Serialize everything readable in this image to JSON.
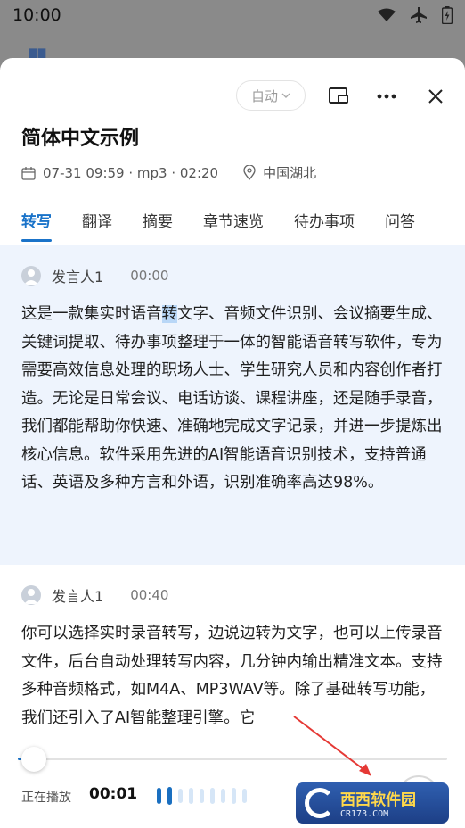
{
  "status_bar": {
    "time": "10:00"
  },
  "header": {
    "auto_label": "自动"
  },
  "record": {
    "title": "简体中文示例",
    "date": "07-31 09:59 · mp3 · 02:20",
    "location": "中国湖北"
  },
  "tabs": [
    {
      "label": "转写",
      "active": true
    },
    {
      "label": "翻译",
      "active": false
    },
    {
      "label": "摘要",
      "active": false
    },
    {
      "label": "章节速览",
      "active": false
    },
    {
      "label": "待办事项",
      "active": false
    },
    {
      "label": "问答",
      "active": false
    }
  ],
  "segments": [
    {
      "speaker": "发言人1",
      "time": "00:00",
      "text_before": "这是一款集实时语音",
      "text_highlight": "转",
      "text_after": "文字、音频文件识别、会议摘要生成、关键词提取、待办事项整理于一体的智能语音转写软件，专为需要高效信息处理的职场人士、学生研究人员和内容创作者打造。无论是日常会议、电话访谈、课程讲座，还是随手录音，我们都能帮助你快速、准确地完成文字记录，并进一步提炼出核心信息。软件采用先进的AI智能语音识别技术，支持普通话、英语及多种方言和外语，识别准确率高达98%。"
    },
    {
      "speaker": "发言人1",
      "time": "00:40",
      "text": "你可以选择实时录音转写，边说边转为文字，也可以上传录音文件，后台自动处理转写内容，几分钟内输出精准文本。支持多种音频格式，如M4A、MP3WAV等。除了基础转写功能，我们还引入了AI智能整理引擎。它"
    }
  ],
  "player": {
    "state": "正在播放",
    "current_time": "00:01",
    "progress": 0.01,
    "wave_active_bars": 2,
    "wave_total_bars": 9
  },
  "watermark": {
    "main": "西西软件园",
    "sub": "CR173.COM"
  },
  "colors": {
    "accent": "#1a73c9",
    "highlight_bg": "#eef4fd"
  }
}
